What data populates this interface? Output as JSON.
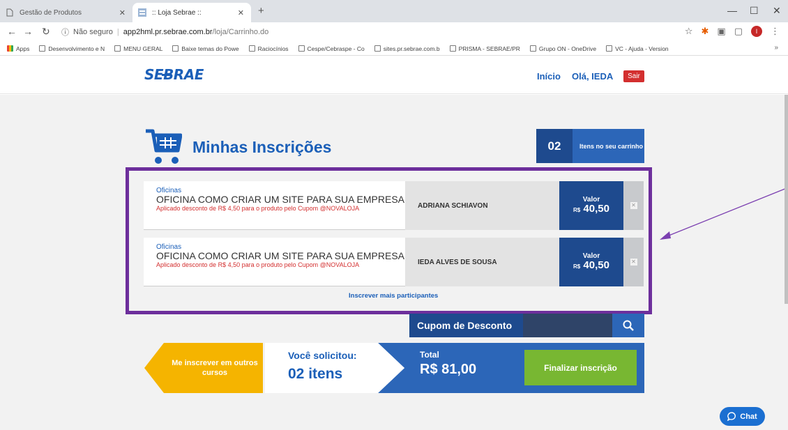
{
  "browser": {
    "tabs": [
      {
        "title": "Gestão de Produtos"
      },
      {
        "title": ":: Loja Sebrae ::"
      }
    ],
    "address": {
      "security": "Não seguro",
      "host": "app2hml.pr.sebrae.com.br",
      "path": "/loja/Carrinho.do"
    },
    "bookmarks": [
      "Apps",
      "Desenvolvimento e N",
      "MENU GERAL",
      "Baixe temas do Powe",
      "Raciocínios",
      "Cespe/Cebraspe - Co",
      "sites.pr.sebrae.com.b",
      "PRISMA - SEBRAE/PR",
      "Grupo ON - OneDrive",
      "VC - Ajuda - Version"
    ],
    "profile_initial": "I"
  },
  "header": {
    "logo": "SEBRAE",
    "nav_home": "Início",
    "greeting": "Olá, IEDA",
    "logout": "Sair"
  },
  "cart": {
    "title": "Minhas Inscrições",
    "count": "02",
    "count_label": "Itens no seu carrinho",
    "items": [
      {
        "category": "Oficinas",
        "title": "OFICINA COMO CRIAR UM SITE PARA SUA EMPRESA",
        "discount": "Aplicado desconto de R$ 4,50 para o produto pelo Cupom @NOVALOJA",
        "participant": "ADRIANA SCHIAVON",
        "price_label": "Valor",
        "currency": "R$",
        "price": "40,50"
      },
      {
        "category": "Oficinas",
        "title": "OFICINA COMO CRIAR UM SITE PARA SUA EMPRESA",
        "discount": "Aplicado desconto de R$ 4,50 para o produto pelo Cupom @NOVALOJA",
        "participant": "IEDA ALVES DE SOUSA",
        "price_label": "Valor",
        "currency": "R$",
        "price": "40,50"
      }
    ],
    "add_more": "Inscrever mais participantes",
    "coupon_label": "Cupom de Desconto",
    "coupon_value": ""
  },
  "summary": {
    "other_courses": "Me inscrever em outros cursos",
    "requested_label": "Você solicitou:",
    "requested_count": "02 itens",
    "total_label": "Total",
    "total_value": "R$ 81,00",
    "finalize": "Finalizar inscrição"
  },
  "chat": {
    "label": "Chat"
  },
  "colors": {
    "brand_blue": "#1b5fb8",
    "dark_blue": "#1e4a8e",
    "highlight_purple": "#6d2f9c",
    "annotation_arrow": "#7b3fb0",
    "finalize_green": "#78b732",
    "other_courses_yellow": "#f5b400",
    "logout_red": "#d32f2f"
  }
}
